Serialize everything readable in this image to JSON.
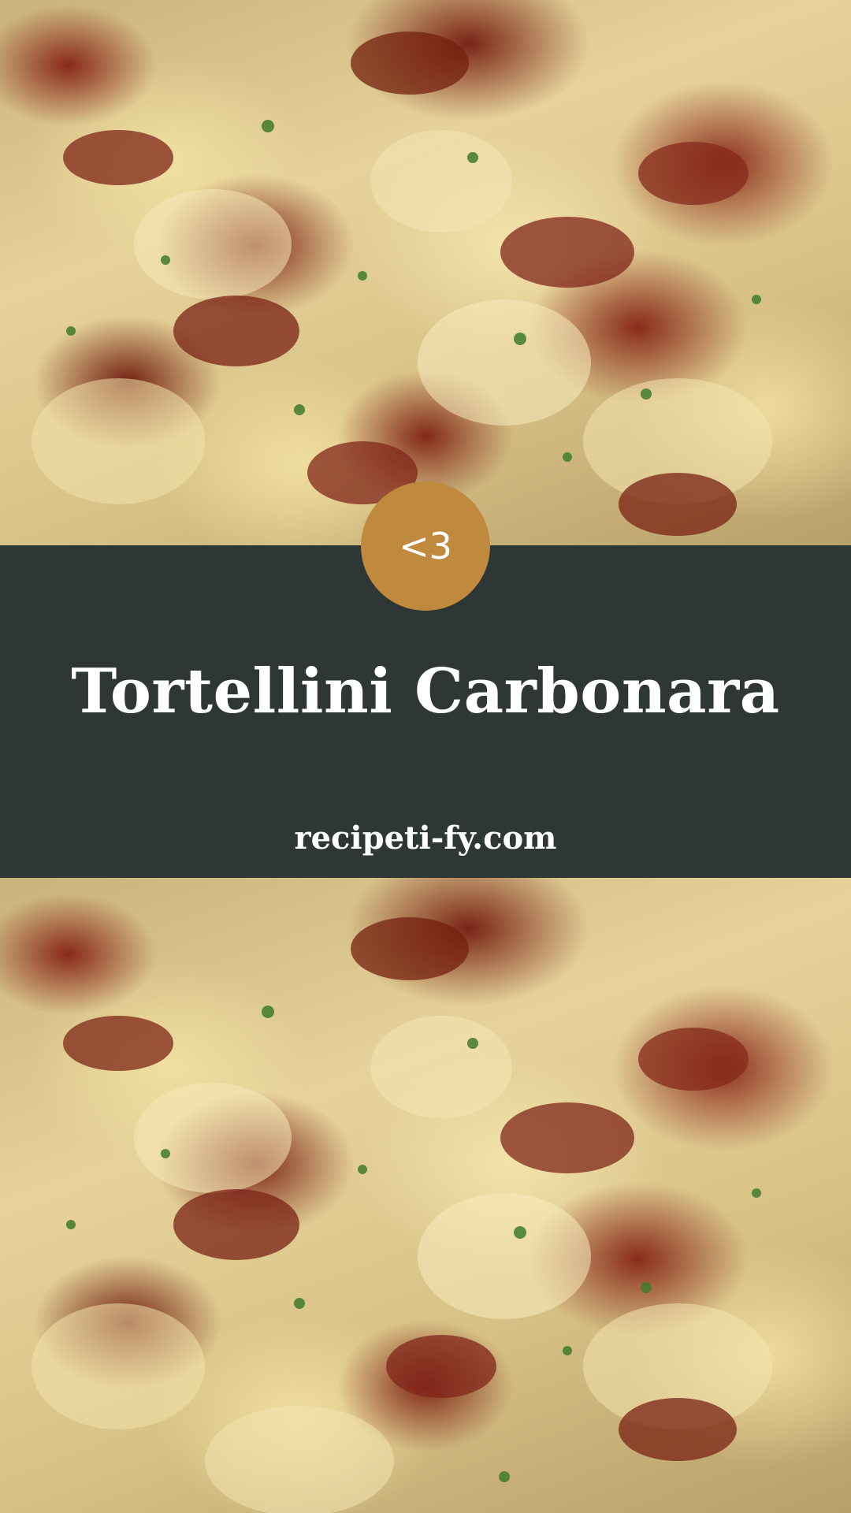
{
  "photo": {
    "top_alt": "tortellini-carbonara-dish-photo",
    "bottom_alt": "tortellini-carbonara-dish-photo"
  },
  "badge": {
    "label": "<3"
  },
  "band": {
    "title": "Tortellini Carbonara",
    "website": "recipeti-fy.com"
  },
  "colors": {
    "band_background": "#2f3636",
    "badge_background": "#c08a3e",
    "text": "#ffffff"
  }
}
